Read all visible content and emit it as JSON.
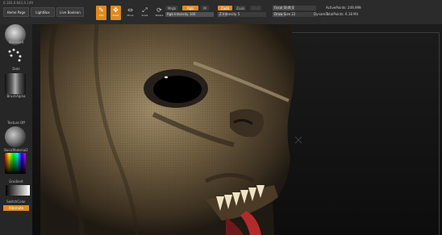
{
  "topbar": {
    "coord": "0.183,0.842,0.149",
    "home_label": "Home Page",
    "lightbox_label": "LightBox",
    "live_boolean_label": "Live Boolean",
    "edit_label": "Edit",
    "draw_label": "Draw",
    "move_label": "Move",
    "scale_label": "Scale",
    "rotate_label": "Rotate",
    "mrgb_label": "Mrgb",
    "rgb_label": "Rgb",
    "m_label": "M",
    "zadd_label": "Zadd",
    "zsub_label": "Zsub",
    "zcut_label": "Zcut",
    "rgb_intensity_label": "Rgb Intensity",
    "rgb_intensity_value": "100",
    "z_intensity_label": "Z Intensity",
    "z_intensity_value": "5",
    "focal_shift_label": "Focal Shift",
    "focal_shift_value": "0",
    "draw_size_label": "Draw Size",
    "draw_size_value": "22",
    "dynamic_label": "Dynamic",
    "active_points_label": "ActivePoints:",
    "active_points_value": "249,999",
    "total_points_label": "TotalPoints:",
    "total_points_value": "6.18 Mil",
    "accent": "#e08a1e"
  },
  "sidebar": {
    "brush_label": "Standard",
    "stroke_label": "Dots",
    "alpha_label": "BrushAlpha",
    "texture_label": "Texture Off",
    "material_label": "BasicMaterial2",
    "gradient_label": "Gradient",
    "switch_color_label": "SwitchColor",
    "alternate_label": "Alternate"
  }
}
